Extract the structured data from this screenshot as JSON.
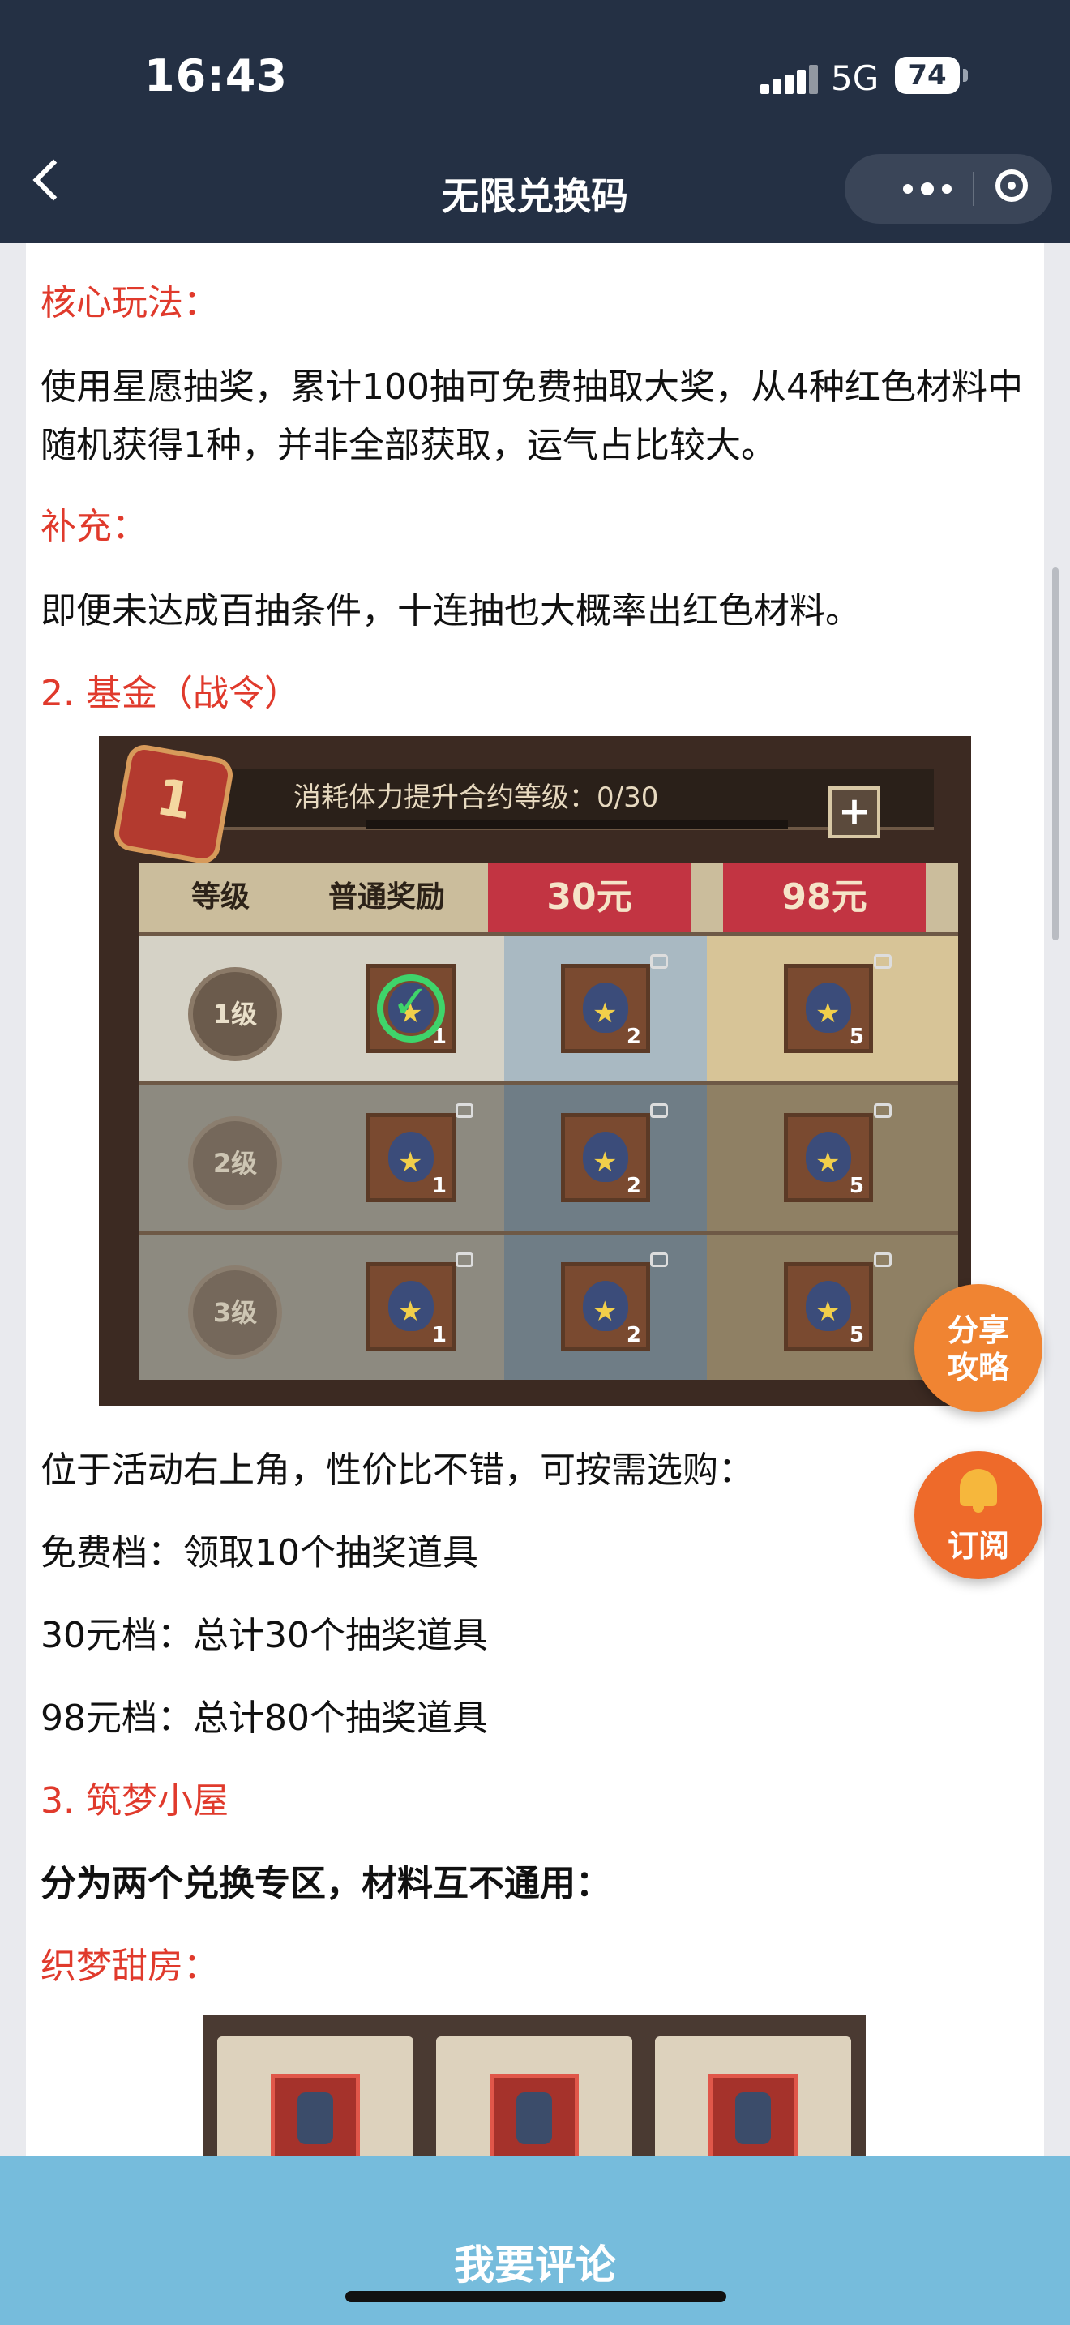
{
  "status_bar": {
    "time": "16:43",
    "network": "5G",
    "battery": "74"
  },
  "nav": {
    "title": "无限兑换码"
  },
  "article": {
    "h_core": "核心玩法：",
    "p_core": "使用星愿抽奖，累计100抽可免费抽取大奖，从4种红色材料中随机获得1种，并非全部获取，运气占比较大。",
    "h_supplement": "补充：",
    "p_supplement": "即便未达成百抽条件，十连抽也大概率出红色材料。",
    "h_fund": "2. 基金（战令）",
    "p_fund_intro": "位于活动右上角，性价比不错，可按需选购：",
    "p_free": "免费档：领取10个抽奖道具",
    "p_30": "30元档：总计30个抽奖道具",
    "p_98": "98元档：总计80个抽奖道具",
    "h_dream": "3. 筑梦小屋",
    "p_dream_bold": "分为两个兑换专区，材料互不通用：",
    "h_sweet": "织梦甜房："
  },
  "game_image": {
    "badge": "1",
    "header_text": "消耗体力提升合约等级：0/30",
    "col_level": "等级",
    "col_normal": "普通奖励",
    "col_30": "30元",
    "col_98": "98元",
    "rows": [
      {
        "level": "1级",
        "q1": "1",
        "q2": "2",
        "q3": "5"
      },
      {
        "level": "2级",
        "q1": "1",
        "q2": "2",
        "q3": "5"
      },
      {
        "level": "3级",
        "q1": "1",
        "q2": "2",
        "q3": "5"
      }
    ]
  },
  "floating": {
    "share_line1": "分享",
    "share_line2": "攻略",
    "subscribe": "订阅"
  },
  "bottom": {
    "comment": "我要评论"
  }
}
